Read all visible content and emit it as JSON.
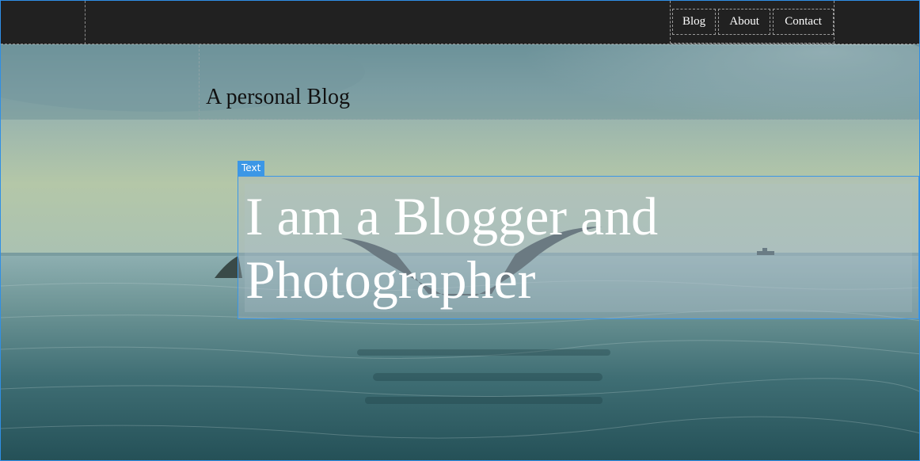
{
  "nav": {
    "items": [
      {
        "label": "Blog"
      },
      {
        "label": "About"
      },
      {
        "label": "Contact"
      }
    ]
  },
  "header": {
    "tagline": "A personal Blog"
  },
  "editor": {
    "element_tag": "Text"
  },
  "hero": {
    "title": "I am a Blogger and Photographer"
  },
  "colors": {
    "navbar_bg": "#212121",
    "selection_blue": "#3c97e6",
    "hero_text": "#ffffff"
  }
}
